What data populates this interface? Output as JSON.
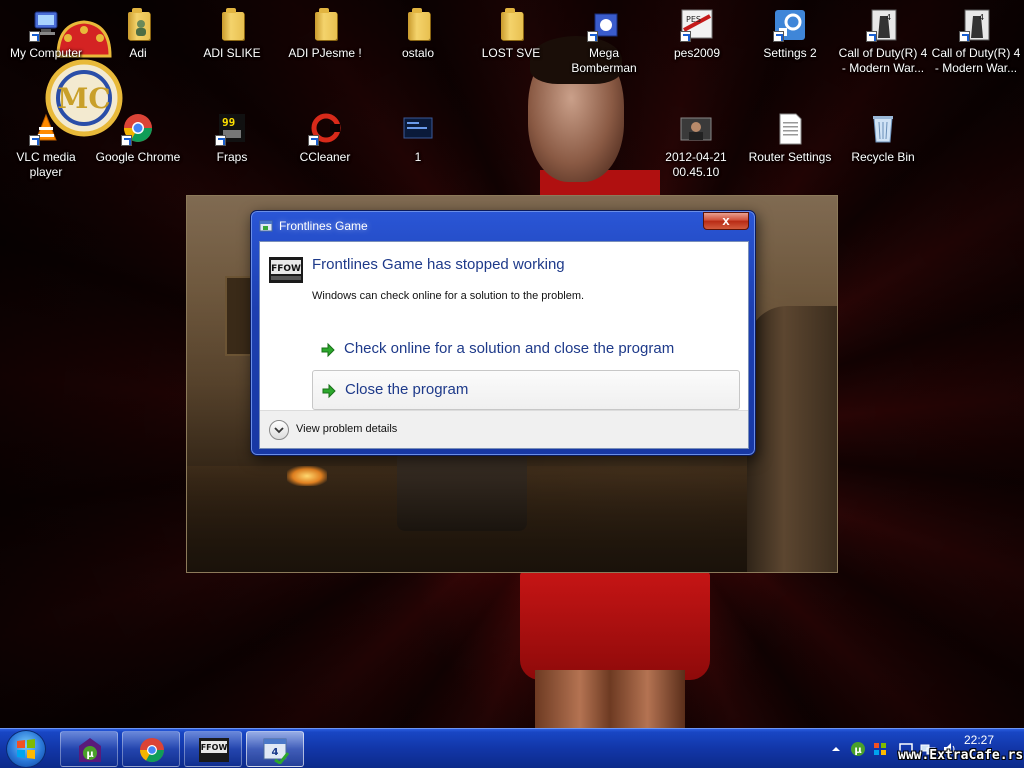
{
  "desktop": {
    "icons": [
      {
        "label": "My Computer",
        "icon": "computer-icon"
      },
      {
        "label": "Adi",
        "icon": "user-folder-icon"
      },
      {
        "label": "ADI SLIKE",
        "icon": "folder-icon"
      },
      {
        "label": "ADI  PJesme !",
        "icon": "folder-icon"
      },
      {
        "label": "ostalo",
        "icon": "folder-icon"
      },
      {
        "label": "LOST SVE",
        "icon": "folder-icon"
      },
      {
        "label": "Mega Bomberman",
        "icon": "game-icon"
      },
      {
        "label": "pes2009",
        "icon": "pes-icon"
      },
      {
        "label": "Settings 2",
        "icon": "settings-icon"
      },
      {
        "label": "Call of Duty(R) 4 - Modern War...",
        "icon": "cod-icon"
      },
      {
        "label": "Call of Duty(R) 4 - Modern War...",
        "icon": "cod-icon"
      },
      {
        "label": "VLC media player",
        "icon": "vlc-icon"
      },
      {
        "label": "Google Chrome",
        "icon": "chrome-icon"
      },
      {
        "label": "Fraps",
        "icon": "fraps-icon"
      },
      {
        "label": "CCleaner",
        "icon": "ccleaner-icon"
      },
      {
        "label": "1",
        "icon": "screen-icon"
      },
      {
        "label": "2012-04-21 00.45.10",
        "icon": "photo-icon"
      },
      {
        "label": "Router Settings",
        "icon": "document-icon"
      },
      {
        "label": "Recycle Bin",
        "icon": "recycle-bin-icon"
      }
    ]
  },
  "dialog": {
    "title": "Frontlines Game",
    "heading": "Frontlines Game has stopped working",
    "subtext": "Windows can check online for a solution to the problem.",
    "close_label": "x",
    "options": [
      {
        "label": "Check online for a solution and close the program"
      },
      {
        "label": "Close the program"
      }
    ],
    "details_label": "View problem details"
  },
  "taskbar": {
    "clock": "22:27",
    "pinned": [
      "utorrent-icon",
      "chrome-icon",
      "ffow-icon",
      "task-manager-icon"
    ]
  },
  "watermark": "www.ExtraCafe.rs",
  "colors": {
    "dialog_frame": "#1d3fb0",
    "heading_text": "#1e3a8a",
    "taskbar": "#1236a8"
  }
}
